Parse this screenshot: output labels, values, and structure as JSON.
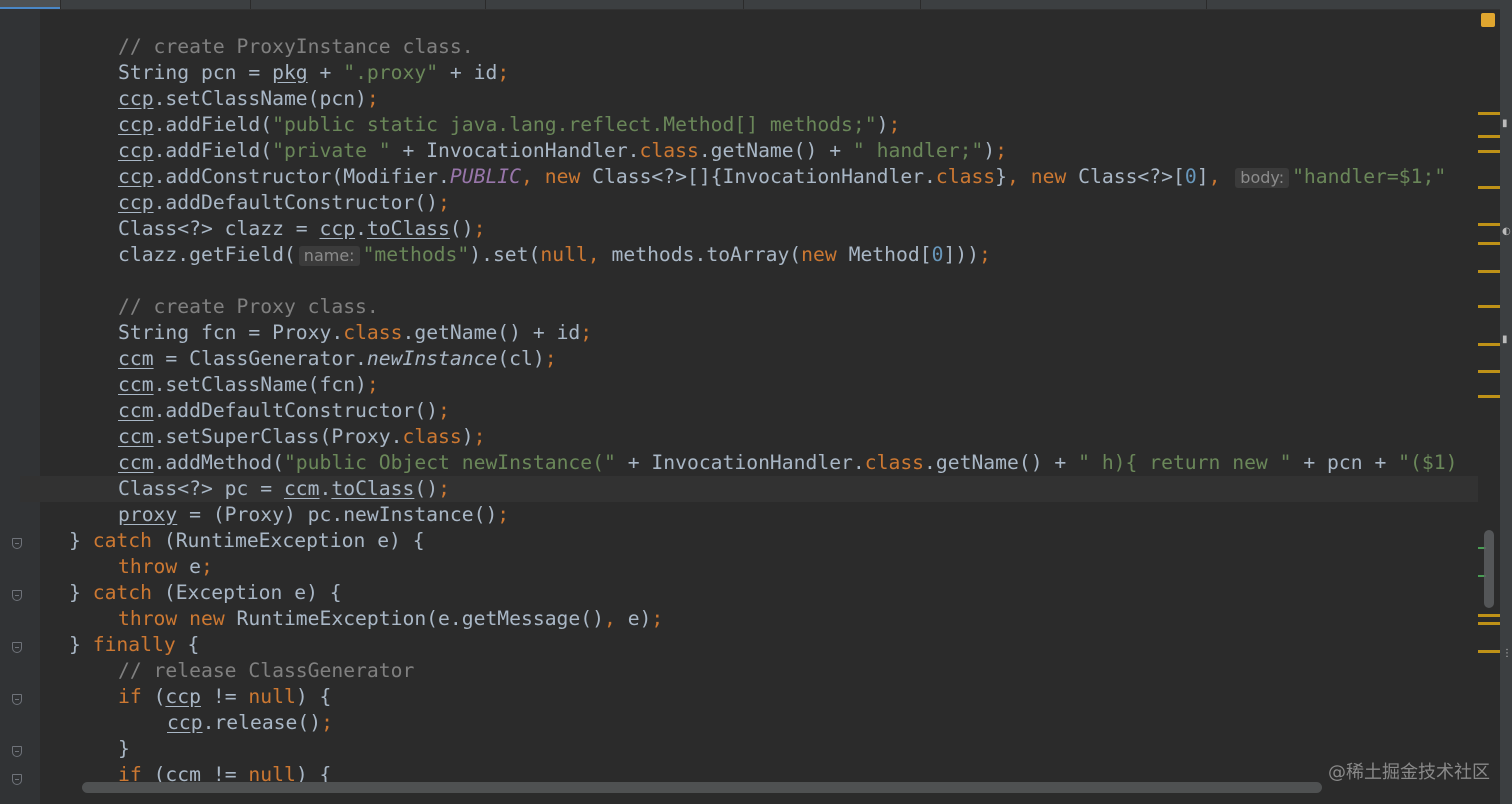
{
  "editor": {
    "lines": [
      {
        "indent": 1,
        "tokens": [
          {
            "t": "// create ProxyInstance class.",
            "c": "c"
          }
        ]
      },
      {
        "indent": 1,
        "tokens": [
          {
            "t": "String pcn = "
          },
          {
            "t": "pkg",
            "c": "u"
          },
          {
            "t": " + "
          },
          {
            "t": "\".proxy\"",
            "c": "s"
          },
          {
            "t": " + id"
          },
          {
            "t": ";",
            "c": "k"
          }
        ]
      },
      {
        "indent": 1,
        "tokens": [
          {
            "t": "ccp",
            "c": "u"
          },
          {
            "t": ".setClassName(pcn)"
          },
          {
            "t": ";",
            "c": "k"
          }
        ]
      },
      {
        "indent": 1,
        "tokens": [
          {
            "t": "ccp",
            "c": "u"
          },
          {
            "t": ".addField("
          },
          {
            "t": "\"public static java.lang.reflect.Method[] methods;\"",
            "c": "s"
          },
          {
            "t": ")"
          },
          {
            "t": ";",
            "c": "k"
          }
        ]
      },
      {
        "indent": 1,
        "tokens": [
          {
            "t": "ccp",
            "c": "u"
          },
          {
            "t": ".addField("
          },
          {
            "t": "\"private \"",
            "c": "s"
          },
          {
            "t": " + InvocationHandler."
          },
          {
            "t": "class",
            "c": "k"
          },
          {
            "t": ".getName() + "
          },
          {
            "t": "\" handler;\"",
            "c": "s"
          },
          {
            "t": ")"
          },
          {
            "t": ";",
            "c": "k"
          }
        ]
      },
      {
        "indent": 1,
        "tokens": [
          {
            "t": "ccp",
            "c": "u"
          },
          {
            "t": ".addConstructor(Modifier."
          },
          {
            "t": "PUBLIC",
            "c": "f"
          },
          {
            "t": ", ",
            "c": "k"
          },
          {
            "t": "new ",
            "c": "k"
          },
          {
            "t": "Class<?>[]{InvocationHandler."
          },
          {
            "t": "class",
            "c": "k"
          },
          {
            "t": "}"
          },
          {
            "t": ", ",
            "c": "k"
          },
          {
            "t": "new ",
            "c": "k"
          },
          {
            "t": "Class<?>["
          },
          {
            "t": "0",
            "c": "n"
          },
          {
            "t": "]"
          },
          {
            "t": ", ",
            "c": "k"
          },
          {
            "t": "body:",
            "c": "hint"
          },
          {
            "t": "\"handler=$1;\"",
            "c": "s"
          }
        ]
      },
      {
        "indent": 1,
        "tokens": [
          {
            "t": "ccp",
            "c": "u"
          },
          {
            "t": ".addDefaultConstructor()"
          },
          {
            "t": ";",
            "c": "k"
          }
        ]
      },
      {
        "indent": 1,
        "tokens": [
          {
            "t": "Class<?> clazz = "
          },
          {
            "t": "ccp",
            "c": "u"
          },
          {
            "t": "."
          },
          {
            "t": "toClass",
            "c": "u"
          },
          {
            "t": "()"
          },
          {
            "t": ";",
            "c": "k"
          }
        ]
      },
      {
        "indent": 1,
        "tokens": [
          {
            "t": "clazz.getField("
          },
          {
            "t": "name:",
            "c": "hint"
          },
          {
            "t": "\"methods\"",
            "c": "s"
          },
          {
            "t": ").set("
          },
          {
            "t": "null",
            "c": "k"
          },
          {
            "t": ", ",
            "c": "k"
          },
          {
            "t": "methods.toArray("
          },
          {
            "t": "new ",
            "c": "k"
          },
          {
            "t": "Method["
          },
          {
            "t": "0",
            "c": "n"
          },
          {
            "t": "]))"
          },
          {
            "t": ";",
            "c": "k"
          }
        ]
      },
      {
        "indent": 1,
        "tokens": []
      },
      {
        "indent": 1,
        "tokens": [
          {
            "t": "// create Proxy class.",
            "c": "c"
          }
        ]
      },
      {
        "indent": 1,
        "tokens": [
          {
            "t": "String fcn = Proxy."
          },
          {
            "t": "class",
            "c": "k"
          },
          {
            "t": ".getName() + id"
          },
          {
            "t": ";",
            "c": "k"
          }
        ]
      },
      {
        "indent": 1,
        "tokens": [
          {
            "t": "ccm",
            "c": "u"
          },
          {
            "t": " = ClassGenerator."
          },
          {
            "t": "newInstance",
            "c": "i"
          },
          {
            "t": "(cl)"
          },
          {
            "t": ";",
            "c": "k"
          }
        ]
      },
      {
        "indent": 1,
        "tokens": [
          {
            "t": "ccm",
            "c": "u"
          },
          {
            "t": ".setClassName(fcn)"
          },
          {
            "t": ";",
            "c": "k"
          }
        ]
      },
      {
        "indent": 1,
        "tokens": [
          {
            "t": "ccm",
            "c": "u"
          },
          {
            "t": ".addDefaultConstructor()"
          },
          {
            "t": ";",
            "c": "k"
          }
        ]
      },
      {
        "indent": 1,
        "tokens": [
          {
            "t": "ccm",
            "c": "u"
          },
          {
            "t": ".setSuperClass(Proxy."
          },
          {
            "t": "class",
            "c": "k"
          },
          {
            "t": ")"
          },
          {
            "t": ";",
            "c": "k"
          }
        ]
      },
      {
        "indent": 1,
        "tokens": [
          {
            "t": "ccm",
            "c": "u"
          },
          {
            "t": ".addMethod("
          },
          {
            "t": "\"public Object newInstance(\"",
            "c": "s"
          },
          {
            "t": " + InvocationHandler."
          },
          {
            "t": "class",
            "c": "k"
          },
          {
            "t": ".getName() + "
          },
          {
            "t": "\" h){ return new \"",
            "c": "s"
          },
          {
            "t": " + pcn + "
          },
          {
            "t": "\"($1)",
            "c": "s"
          }
        ]
      },
      {
        "indent": 1,
        "current": true,
        "tokens": [
          {
            "t": "Class<?> pc = "
          },
          {
            "t": "ccm",
            "c": "u"
          },
          {
            "t": "."
          },
          {
            "t": "toClass",
            "c": "u"
          },
          {
            "t": "()"
          },
          {
            "t": ";",
            "c": "k"
          }
        ]
      },
      {
        "indent": 1,
        "tokens": [
          {
            "t": "proxy",
            "c": "u"
          },
          {
            "t": " = (Proxy) pc.newInstance()"
          },
          {
            "t": ";",
            "c": "k"
          }
        ]
      },
      {
        "indent": 0,
        "tokens": [
          {
            "t": "} "
          },
          {
            "t": "catch ",
            "c": "k"
          },
          {
            "t": "(RuntimeException e) {"
          }
        ]
      },
      {
        "indent": 1,
        "tokens": [
          {
            "t": "throw ",
            "c": "k"
          },
          {
            "t": "e"
          },
          {
            "t": ";",
            "c": "k"
          }
        ]
      },
      {
        "indent": 0,
        "tokens": [
          {
            "t": "} "
          },
          {
            "t": "catch ",
            "c": "k"
          },
          {
            "t": "(Exception e) {"
          }
        ]
      },
      {
        "indent": 1,
        "tokens": [
          {
            "t": "throw new ",
            "c": "k"
          },
          {
            "t": "RuntimeException(e.getMessage()"
          },
          {
            "t": ", ",
            "c": "k"
          },
          {
            "t": "e)"
          },
          {
            "t": ";",
            "c": "k"
          }
        ]
      },
      {
        "indent": 0,
        "tokens": [
          {
            "t": "} "
          },
          {
            "t": "finally ",
            "c": "k"
          },
          {
            "t": "{"
          }
        ]
      },
      {
        "indent": 1,
        "tokens": [
          {
            "t": "// release ClassGenerator",
            "c": "c"
          }
        ]
      },
      {
        "indent": 1,
        "tokens": [
          {
            "t": "if ",
            "c": "k"
          },
          {
            "t": "("
          },
          {
            "t": "ccp",
            "c": "u"
          },
          {
            "t": " != "
          },
          {
            "t": "null",
            "c": "k"
          },
          {
            "t": ") {"
          }
        ]
      },
      {
        "indent": 2,
        "tokens": [
          {
            "t": "ccp",
            "c": "u"
          },
          {
            "t": ".release()"
          },
          {
            "t": ";",
            "c": "k"
          }
        ]
      },
      {
        "indent": 1,
        "tokens": [
          {
            "t": "}"
          }
        ]
      },
      {
        "indent": 1,
        "tokens": [
          {
            "t": "if ",
            "c": "k"
          },
          {
            "t": "("
          },
          {
            "t": "ccm",
            "c": "u"
          },
          {
            "t": " != "
          },
          {
            "t": "null",
            "c": "k"
          },
          {
            "t": ") {"
          }
        ]
      }
    ]
  },
  "watermark": "@稀土掘金技术社区"
}
